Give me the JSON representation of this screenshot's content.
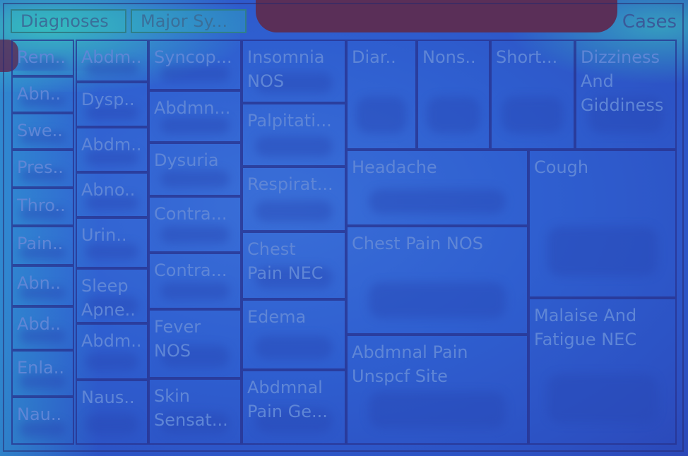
{
  "chart_data": {
    "type": "treemap",
    "title": "",
    "levels": [
      "Diagnoses",
      "Major Sy..."
    ],
    "size_label": "Cases",
    "nodes": [
      "Rem..",
      "Abn..",
      "Swe..",
      "Pres..",
      "Thro..",
      "Pain..",
      "Abn..",
      "Abd..",
      "Enla..",
      "Nau..",
      "Abdm..",
      "Dysp..",
      "Abdm..",
      "Abno..",
      "Urin..",
      "Sleep\nApne..",
      "Abdm..",
      "Naus..",
      "Syncop...",
      "Abdmn...",
      "Dysuria",
      "Contra...",
      "Contra...",
      "Fever\nNOS",
      "Skin\nSensat...",
      "Insomnia\nNOS",
      "Palpitati...",
      "Respirat...",
      "Chest\nPain NEC",
      "Edema",
      "Abdmnal\nPain Ge...",
      "Diar..",
      "Nons..",
      "Short...",
      "Dizziness\nAnd\nGiddiness",
      "Headache",
      "Cough",
      "Chest Pain NOS",
      "Malaise And\nFatigue NEC",
      "Abdmnal Pain\nUnspcf Site"
    ]
  },
  "header": {
    "breadcrumb_1": "Diagnoses",
    "breadcrumb_2": "Major Sy...",
    "size_label": "Cases"
  }
}
